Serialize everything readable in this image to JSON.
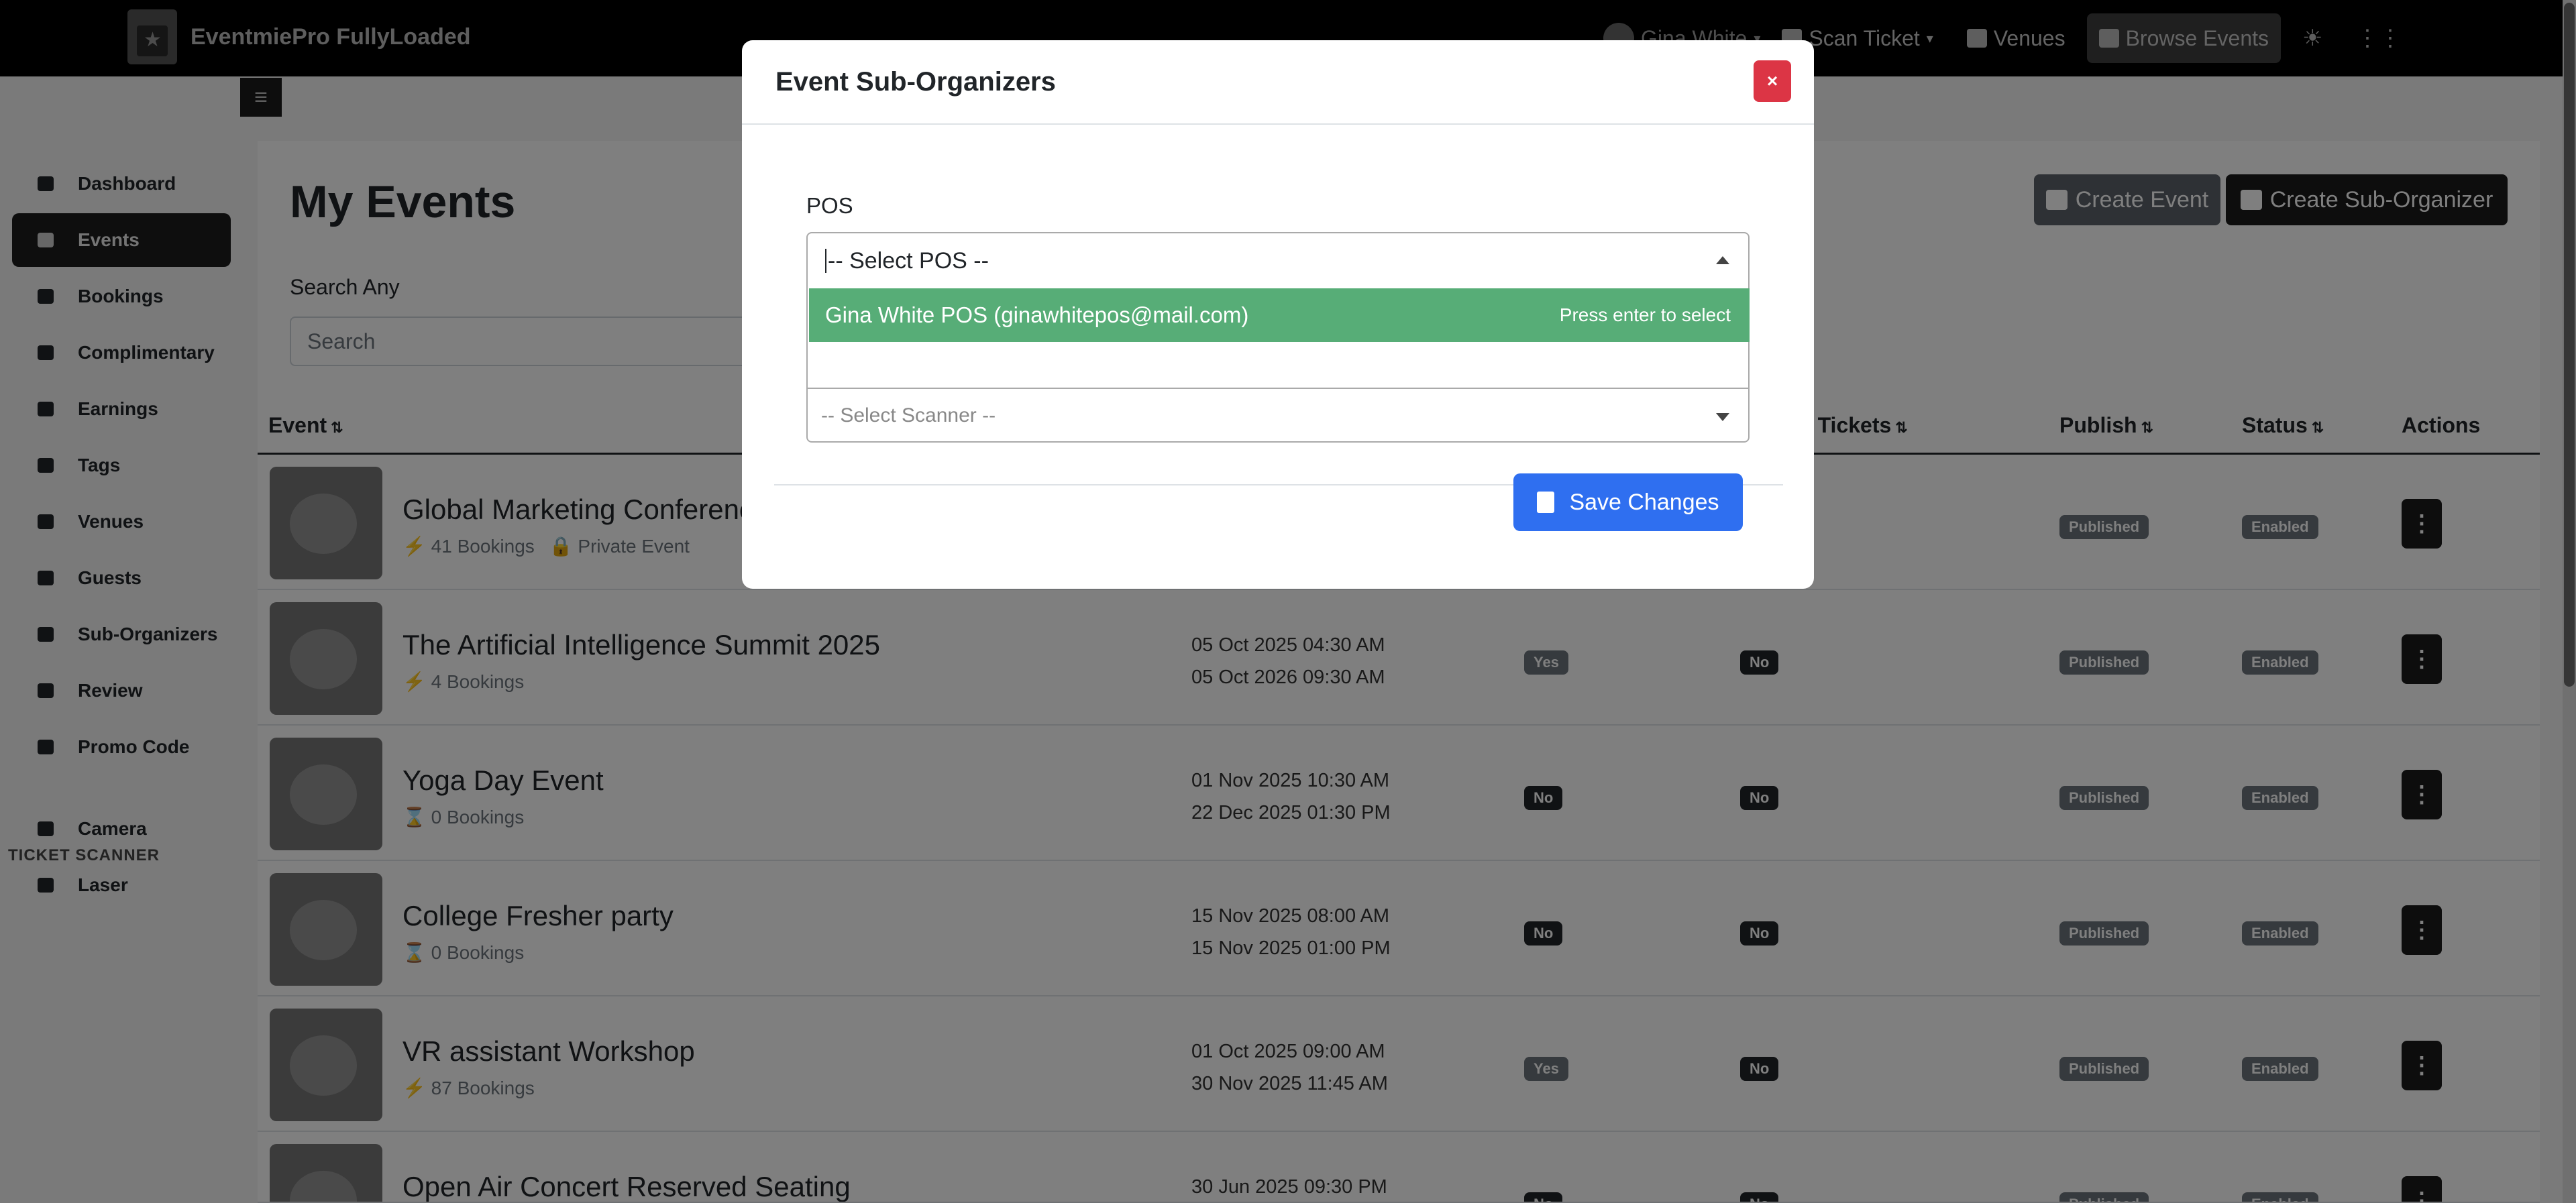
{
  "topbar": {
    "brand": "EventmiePro FullyLoaded",
    "user": "Gina White",
    "scan_ticket": "Scan Ticket",
    "venues": "Venues",
    "browse_events": "Browse Events"
  },
  "sidebar": {
    "items": [
      {
        "label": "Dashboard",
        "icon": "gauge-icon"
      },
      {
        "label": "Events",
        "icon": "calendar-icon"
      },
      {
        "label": "Bookings",
        "icon": "ticket-icon"
      },
      {
        "label": "Complimentary",
        "icon": "puzzle-icon"
      },
      {
        "label": "Earnings",
        "icon": "wallet-icon"
      },
      {
        "label": "Tags",
        "icon": "user-tag-icon"
      },
      {
        "label": "Venues",
        "icon": "map-icon"
      },
      {
        "label": "Guests",
        "icon": "users-icon"
      },
      {
        "label": "Sub-Organizers",
        "icon": "sitemap-icon"
      },
      {
        "label": "Review",
        "icon": "star-icon"
      },
      {
        "label": "Promo Code",
        "icon": "tag-icon"
      }
    ],
    "scanner_heading": "TICKET SCANNER",
    "scanner_items": [
      {
        "label": "Camera",
        "icon": "qrcode-icon"
      },
      {
        "label": "Laser",
        "icon": "barcode-icon"
      }
    ]
  },
  "main": {
    "title": "My Events",
    "create_event": "Create Event",
    "create_sub_organizer": "Create Sub-Organizer",
    "search_label": "Search Any",
    "search_placeholder": "Search",
    "columns": {
      "event": "Event",
      "manual_tickets": "al Tickets",
      "publish": "Publish",
      "status": "Status",
      "actions": "Actions"
    },
    "rows": [
      {
        "title": "Global Marketing Conference",
        "bookings": "41 Bookings",
        "private": "Private Event",
        "start": "",
        "end": "",
        "a": "",
        "b": "",
        "publish": "Published",
        "status": "Enabled"
      },
      {
        "title": "The Artificial Intelligence Summit 2025",
        "bookings": "4 Bookings",
        "private": "",
        "start": "05 Oct 2025 04:30 AM",
        "end": "05 Oct 2026 09:30 AM",
        "a": "Yes",
        "b": "No",
        "publish": "Published",
        "status": "Enabled"
      },
      {
        "title": "Yoga Day Event",
        "bookings": "0 Bookings",
        "private": "",
        "start": "01 Nov 2025 10:30 AM",
        "end": "22 Dec 2025 01:30 PM",
        "a": "No",
        "b": "No",
        "publish": "Published",
        "status": "Enabled"
      },
      {
        "title": "College Fresher party",
        "bookings": "0 Bookings",
        "private": "",
        "start": "15 Nov 2025 08:00 AM",
        "end": "15 Nov 2025 01:00 PM",
        "a": "No",
        "b": "No",
        "publish": "Published",
        "status": "Enabled"
      },
      {
        "title": "VR assistant Workshop",
        "bookings": "87 Bookings",
        "private": "",
        "start": "01 Oct 2025 09:00 AM",
        "end": "30 Nov 2025 11:45 AM",
        "a": "Yes",
        "b": "No",
        "publish": "Published",
        "status": "Enabled"
      },
      {
        "title": "Open Air Concert Reserved Seating",
        "bookings": "",
        "private": "",
        "start": "30 Jun 2025 09:30 PM",
        "end": "",
        "a": "No",
        "b": "No",
        "publish": "Published",
        "status": "Enabled"
      }
    ]
  },
  "modal": {
    "title": "Event Sub-Organizers",
    "close": "×",
    "pos_label": "POS",
    "pos_placeholder": "-- Select POS --",
    "pos_option": "Gina White POS (ginawhitepos@mail.com)",
    "pos_hint": "Press enter to select",
    "scanner_placeholder": "-- Select Scanner --",
    "save": "Save Changes"
  },
  "colors": {
    "save": "#2f6ff0",
    "close": "#dc3545",
    "option_highlight": "#57ad77"
  }
}
